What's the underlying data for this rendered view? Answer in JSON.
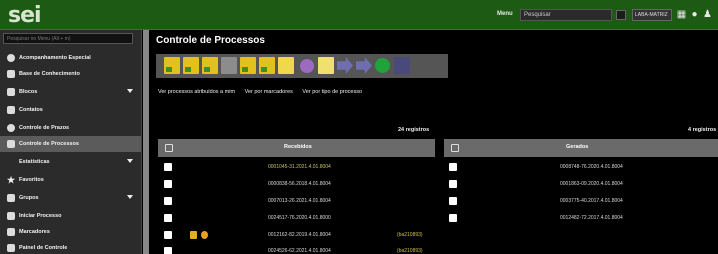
{
  "header": {
    "logo": "sei",
    "unit_label": "Menu",
    "search_placeholder": "Pesquisar",
    "unit_select": "LABA-MATRIZ"
  },
  "sidebar": {
    "search_placeholder": "Pesquisar no Menu (Alt + m)",
    "items": [
      {
        "label": "Acompanhamento Especial",
        "icon": "eye-icon"
      },
      {
        "label": "Base de Conhecimento",
        "icon": "book-icon"
      },
      {
        "label": "Blocos",
        "icon": "block-icon"
      },
      {
        "label": "Contatos",
        "icon": "contacts-icon"
      },
      {
        "label": "Controle de Prazos",
        "icon": "clock-icon"
      },
      {
        "label": "Controle de Processos",
        "icon": "list-icon"
      },
      {
        "label": "Estatísticas",
        "icon": ""
      },
      {
        "label": "Favoritos",
        "icon": "star-icon"
      },
      {
        "label": "Grupos",
        "icon": "group-icon"
      },
      {
        "label": "Iniciar Processo",
        "icon": "folder-icon"
      },
      {
        "label": "Marcadores",
        "icon": "tag-icon"
      },
      {
        "label": "Painel de Controle",
        "icon": "dashboard-icon"
      }
    ]
  },
  "main": {
    "title": "Controle de Processos",
    "links": [
      "Ver processos atribuídos a mim",
      "Ver por marcadores",
      "Ver por tipo de processo"
    ],
    "received": {
      "count": "24 registros",
      "header": "Recebidos",
      "rows": [
        {
          "number": "0001045-31.2021.4.01.8004",
          "tag": ""
        },
        {
          "number": "0000838-56.2018.4.01.8004",
          "tag": ""
        },
        {
          "number": "0007013-26.2021.4.01.8004",
          "tag": ""
        },
        {
          "number": "0024517-76.2020.4.01.8000",
          "tag": ""
        },
        {
          "number": "0012162-82.2019.4.01.8004",
          "tag": "(ba210893)"
        },
        {
          "number": "0024526-62.2021.4.01.8004",
          "tag": "(ba210893)"
        }
      ]
    },
    "generated": {
      "count": "4 registros",
      "header": "Gerados",
      "rows": [
        {
          "number": "0008748-76.2020.4.01.8004"
        },
        {
          "number": "0001863-09.2020.4.01.8004"
        },
        {
          "number": "0003775-40.2017.4.01.8004"
        },
        {
          "number": "0012482-72.2017.4.01.8004"
        }
      ]
    }
  }
}
